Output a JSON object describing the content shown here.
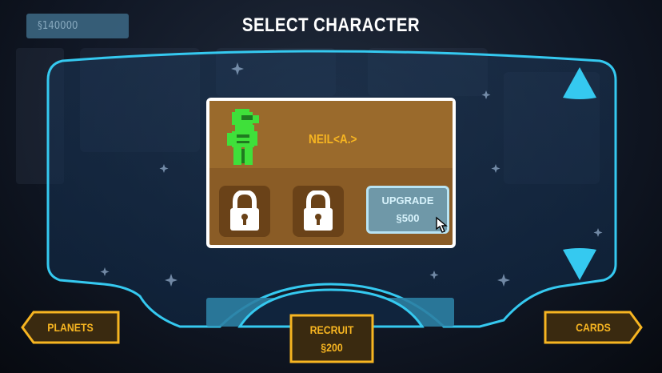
{
  "header": {
    "currency": "§140000",
    "title": "SELECT CHARACTER"
  },
  "character": {
    "name": "NEIL<A.>",
    "sprite_icon": "green-astronaut-sprite",
    "slots": [
      {
        "state": "locked",
        "icon": "padlock-icon"
      },
      {
        "state": "locked",
        "icon": "padlock-icon"
      }
    ],
    "upgrade": {
      "label": "UPGRADE",
      "price": "§500"
    }
  },
  "navigation": {
    "up_icon": "arrow-up-icon",
    "down_icon": "arrow-down-icon"
  },
  "bottom_bar": {
    "planets": "PLANETS",
    "recruit_label": "RECRUIT",
    "recruit_price": "§200",
    "cards": "CARDS"
  },
  "colors": {
    "accent_cyan": "#35c9f0",
    "accent_orange": "#f7b521",
    "card_brown": "#8a5c26",
    "sprite_green": "#3fe03a"
  }
}
